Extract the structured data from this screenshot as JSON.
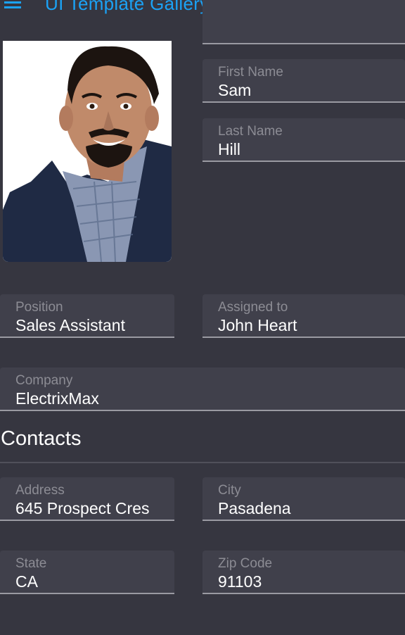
{
  "app": {
    "title": "UI Template Gallery",
    "icons": {
      "menu": "hamburger-menu-icon",
      "notifications": "bell-icon",
      "more": "more-vertical-icon"
    },
    "accent_color": "#1ba2f5"
  },
  "profile": {
    "photo": "employee-photo",
    "first_name": {
      "label": "First Name",
      "value": "Sam"
    },
    "last_name": {
      "label": "Last Name",
      "value": "Hill"
    },
    "position": {
      "label": "Position",
      "value": "Sales Assistant"
    },
    "assigned_to": {
      "label": "Assigned to",
      "value": "John Heart"
    },
    "company": {
      "label": "Company",
      "value": "ElectrixMax"
    }
  },
  "contacts": {
    "title": "Contacts",
    "address": {
      "label": "Address",
      "value": "645 Prospect Cres"
    },
    "city": {
      "label": "City",
      "value": "Pasadena"
    },
    "state": {
      "label": "State",
      "value": "CA"
    },
    "zip": {
      "label": "Zip Code",
      "value": "91103"
    }
  }
}
